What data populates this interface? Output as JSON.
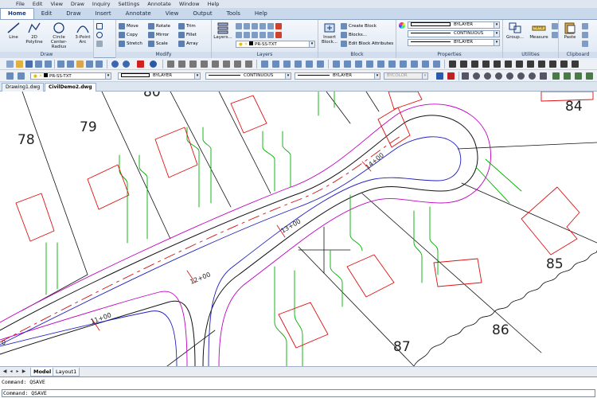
{
  "menu": [
    "File",
    "Edit",
    "View",
    "Draw",
    "Inquiry",
    "Settings",
    "Annotate",
    "Window",
    "Help"
  ],
  "ribbon_tabs": [
    "Home",
    "Edit",
    "Draw",
    "Insert",
    "Annotate",
    "View",
    "Output",
    "Tools",
    "Help"
  ],
  "active_ribbon_tab": "Home",
  "panels": {
    "draw": {
      "title": "Draw",
      "buttons": [
        "Line",
        "2D Polyline",
        "Circle Center-Radius",
        "3-Point Arc"
      ]
    },
    "modify": {
      "title": "Modify",
      "items": [
        "Move",
        "Rotate",
        "Trim",
        "Copy",
        "Mirror",
        "Fillet",
        "Stretch",
        "Scale",
        "Array"
      ]
    },
    "layers": {
      "title": "Layers",
      "button": "Layers...",
      "current_layer": "PR-SS-TXT"
    },
    "block": {
      "title": "Block",
      "big_button": "Insert Block...",
      "items": [
        "Create Block",
        "Blocks...",
        "Edit Block Attributes"
      ]
    },
    "properties": {
      "title": "Properties",
      "color": "BYLAYER",
      "linetype": "CONTINUOUS",
      "lineweight": "BYLAYER"
    },
    "utilities": {
      "title": "Utilities",
      "buttons": [
        "Group...",
        "Measure"
      ]
    },
    "clipboard": {
      "title": "Clipboard",
      "button": "Paste"
    }
  },
  "properties_toolbar": {
    "layer": "PR-SS-TXT",
    "color": "BYLAYER",
    "linetype": "CONTINUOUS",
    "lineweight": "BYLAYER",
    "plotstyle": "BYCOLOR"
  },
  "document_tabs": [
    "Drawing1.dwg",
    "CivilDemo2.dwg"
  ],
  "active_document": "CivilDemo2.dwg",
  "drawing": {
    "lot_numbers": [
      "78",
      "79",
      "80",
      "84",
      "85",
      "86",
      "87"
    ],
    "stations": [
      "11+00",
      "12+00",
      "13+00",
      "14+00",
      "0"
    ]
  },
  "layout_tabs": [
    "Model",
    "Layout1"
  ],
  "active_layout": "Model",
  "command_history": "Command:  QSAVE",
  "command_line": "Command: QSAVE",
  "colors": {
    "road_edge": "#111111",
    "offset_line": "#c000c0",
    "centerline": "#2020c0",
    "driveway": "#00b000",
    "building": "#e01010",
    "station_line": "#d01010"
  }
}
